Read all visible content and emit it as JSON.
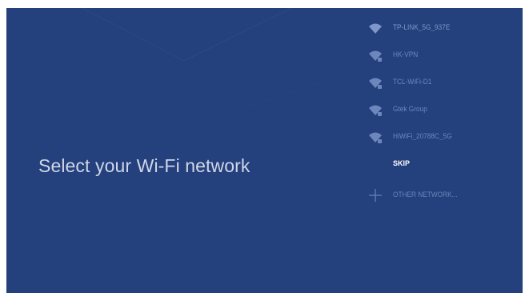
{
  "page": {
    "title": "Select your Wi-Fi network"
  },
  "networks": [
    {
      "ssid": "TP-LINK_5G_937E",
      "icon": "wifi-icon"
    },
    {
      "ssid": "HK-VPN",
      "icon": "wifi-lock-icon"
    },
    {
      "ssid": "TCL-WiFi-D1",
      "icon": "wifi-lock-icon"
    },
    {
      "ssid": "Gtek Group",
      "icon": "wifi-lock-icon"
    },
    {
      "ssid": "HiWiFi_20788C_5G",
      "icon": "wifi-lock-icon"
    }
  ],
  "actions": {
    "skip_label": "SKIP",
    "other_network_label": "OTHER NETWORK..."
  },
  "colors": {
    "background": "#24407d",
    "title": "#cfd6e6",
    "network_text": "#6d87bd",
    "skip_text": "#ffffff"
  }
}
